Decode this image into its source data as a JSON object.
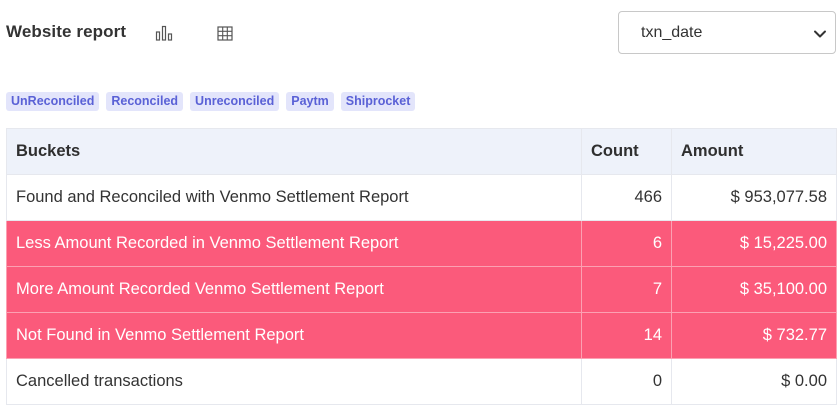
{
  "header": {
    "title": "Website report",
    "chart_icon": "bar-chart-icon",
    "grid_icon": "grid-icon",
    "select_value": "txn_date",
    "select_icon": "chevron-down-icon"
  },
  "chips": [
    "UnReconciled",
    "Reconciled",
    "Unreconciled",
    "Paytm",
    "Shiprocket"
  ],
  "table": {
    "headers": [
      "Buckets",
      "Count",
      "Amount"
    ],
    "rows": [
      {
        "bucket": "Found and Reconciled with Venmo Settlement Report",
        "count": "466",
        "amount": "$ 953,077.58",
        "status": "normal"
      },
      {
        "bucket": "Less Amount Recorded in Venmo Settlement Report",
        "count": "6",
        "amount": "$ 15,225.00",
        "status": "alert"
      },
      {
        "bucket": "More Amount Recorded Venmo Settlement Report",
        "count": "7",
        "amount": "$ 35,100.00",
        "status": "alert"
      },
      {
        "bucket": "Not Found in Venmo Settlement Report",
        "count": "14",
        "amount": "$ 732.77",
        "status": "alert"
      },
      {
        "bucket": "Cancelled transactions",
        "count": "0",
        "amount": "$ 0.00",
        "status": "normal"
      }
    ]
  },
  "colors": {
    "alert_row": "#fb5a7b",
    "chip_bg": "#e3e5fb",
    "chip_text": "#5a61d6",
    "header_bg": "#eef2fa"
  }
}
